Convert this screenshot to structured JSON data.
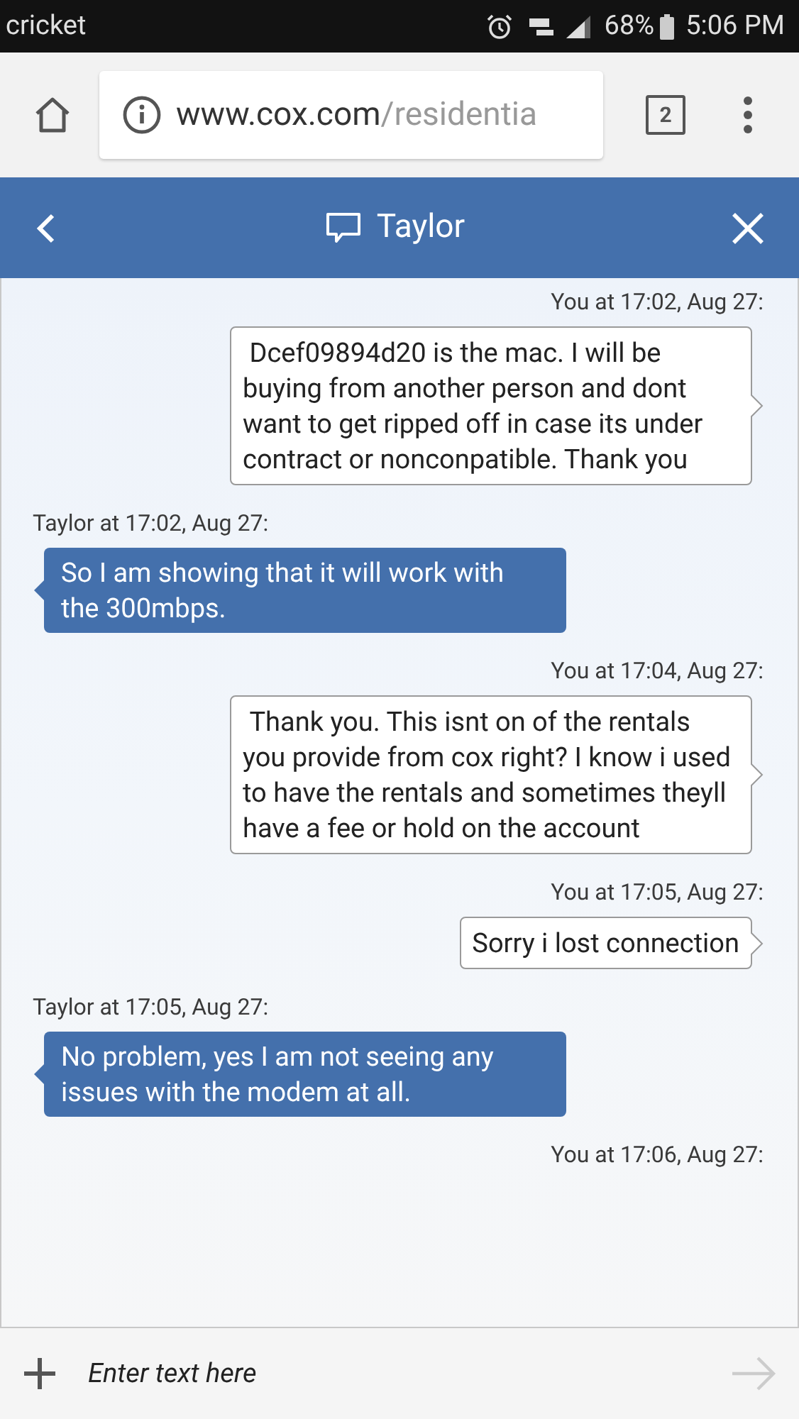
{
  "status_bar": {
    "carrier": "cricket",
    "battery": "68%",
    "time": "5:06 PM"
  },
  "browser": {
    "url_host": "www.cox.com",
    "url_path": "/residentia",
    "tab_count": "2"
  },
  "chat": {
    "title": "Taylor",
    "messages": [
      {
        "kind": "outgoing",
        "sender": "You at 17:02, Aug 27:",
        "text": " Dcef09894d20 is the mac. I will be buying from another person and dont want to get ripped off in case its under contract or nonconpatible. Thank you"
      },
      {
        "kind": "incoming",
        "sender": "Taylor at 17:02, Aug 27:",
        "text": "So I am showing that it will work with the 300mbps."
      },
      {
        "kind": "outgoing",
        "sender": "You at 17:04, Aug 27:",
        "text": " Thank you. This isnt on of the rentals you provide from cox right? I know i used to have the rentals and sometimes theyll have a fee or hold on the account"
      },
      {
        "kind": "outgoing",
        "sender": "You at 17:05, Aug 27:",
        "text": "Sorry i lost connection"
      },
      {
        "kind": "incoming",
        "sender": "Taylor at 17:05, Aug 27:",
        "text": "No problem, yes I am not seeing any issues with the modem at all."
      },
      {
        "kind": "outgoing",
        "sender": "You at 17:06, Aug 27:"
      }
    ]
  },
  "composer": {
    "placeholder": "Enter text here"
  }
}
